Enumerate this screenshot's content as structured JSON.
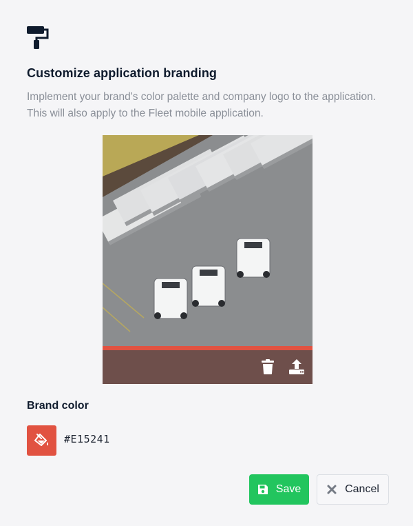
{
  "dialog": {
    "title": "Customize application branding",
    "description": "Implement your brand's color palette and company logo to the application. This will also apply to the Fleet mobile application.",
    "header_icon": "paint-roller-icon"
  },
  "logo": {
    "image_alt": "Aerial view of white trucks parked at loading docks",
    "delete_icon": "trash-icon",
    "upload_icon": "upload-icon"
  },
  "brand_color": {
    "label": "Brand color",
    "value": "#E15241",
    "swatch_icon": "fill-drip-icon"
  },
  "actions": {
    "save_label": "Save",
    "cancel_label": "Cancel",
    "save_icon": "floppy-disk-icon",
    "cancel_icon": "close-icon"
  },
  "colors": {
    "background": "#f5f5f7",
    "brand": "#E15241",
    "logo_backdrop": "#6e4f4b",
    "save_button": "#22c55e",
    "title_text": "#0f1b2d",
    "description_text": "#8a8f98"
  }
}
